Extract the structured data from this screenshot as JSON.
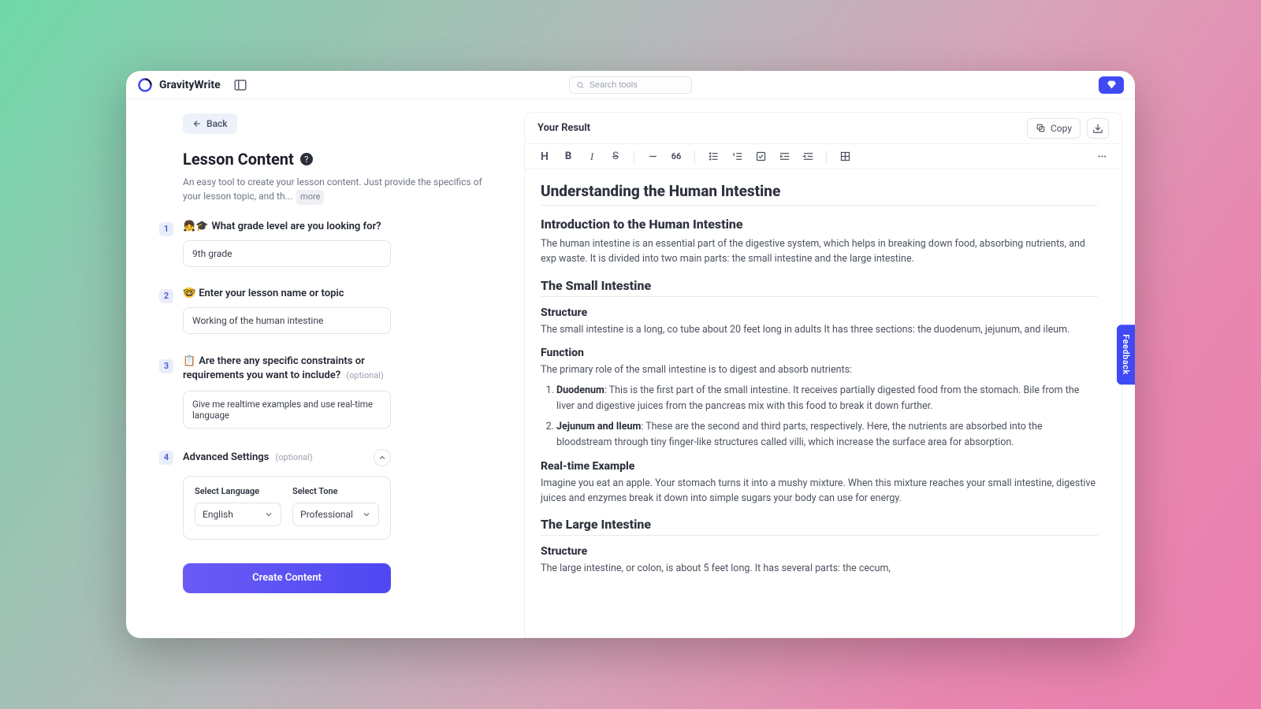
{
  "brand": {
    "name": "GravityWrite"
  },
  "search": {
    "placeholder": "Search tools"
  },
  "back_label": "Back",
  "page": {
    "title": "Lesson Content",
    "description": "An easy tool to create your lesson content. Just provide the specifics of your lesson topic, and th...",
    "more_label": "more"
  },
  "steps": {
    "s1": {
      "num": "1",
      "emoji": "👧🎓",
      "label": "What grade level are you looking for?",
      "value": "9th grade"
    },
    "s2": {
      "num": "2",
      "emoji": "🤓",
      "label": "Enter your lesson name or topic",
      "value": "Working of the human intestine"
    },
    "s3": {
      "num": "3",
      "emoji": "📋",
      "label": "Are there any specific constraints or requirements you want to include?",
      "optional": "(optional)",
      "value": "Give me realtime examples and use real-time language"
    },
    "s4": {
      "num": "4",
      "label": "Advanced Settings",
      "optional": "(optional)"
    }
  },
  "advanced": {
    "lang_label": "Select Language",
    "lang_value": "English",
    "tone_label": "Select Tone",
    "tone_value": "Professional"
  },
  "create_label": "Create Content",
  "result": {
    "header": "Your Result",
    "copy_label": "Copy",
    "h1": "Understanding the Human Intestine",
    "intro_h2": "Introduction to the Human Intestine",
    "intro_p": "The human intestine is an essential part of the digestive system, which helps in breaking down food, absorbing nutrients, and exp waste. It is divided into two main parts: the small intestine and the large intestine.",
    "small_h2": "The Small Intestine",
    "struct_h3": "Structure",
    "struct_p": "The small intestine is a long, co tube about 20 feet long in adults It has three sections: the duodenum, jejunum, and ileum.",
    "func_h3": "Function",
    "func_p": "The primary role of the small intestine is to digest and absorb nutrients:",
    "li1_strong": "Duodenum",
    "li1_rest": ": This is the first part of the small intestine. It receives partially digested food from the stomach. Bile from the liver and digestive juices from the pancreas mix with this food to break it down further.",
    "li2_strong": "Jejunum and Ileum",
    "li2_rest": ": These are the second and third parts, respectively. Here, the nutrients are absorbed into the bloodstream through tiny finger-like structures called villi, which increase the surface area for absorption.",
    "rte_h3": "Real-time Example",
    "rte_p": "Imagine you eat an apple. Your stomach turns it into a mushy mixture. When this mixture reaches your small intestine, digestive juices and enzymes break it down into simple sugars your body can use for energy.",
    "large_h2": "The Large Intestine",
    "large_struct_h3": "Structure",
    "large_struct_p": "The large intestine, or colon, is about 5 feet long. It has several parts: the cecum,"
  },
  "feedback_label": "Feedback"
}
